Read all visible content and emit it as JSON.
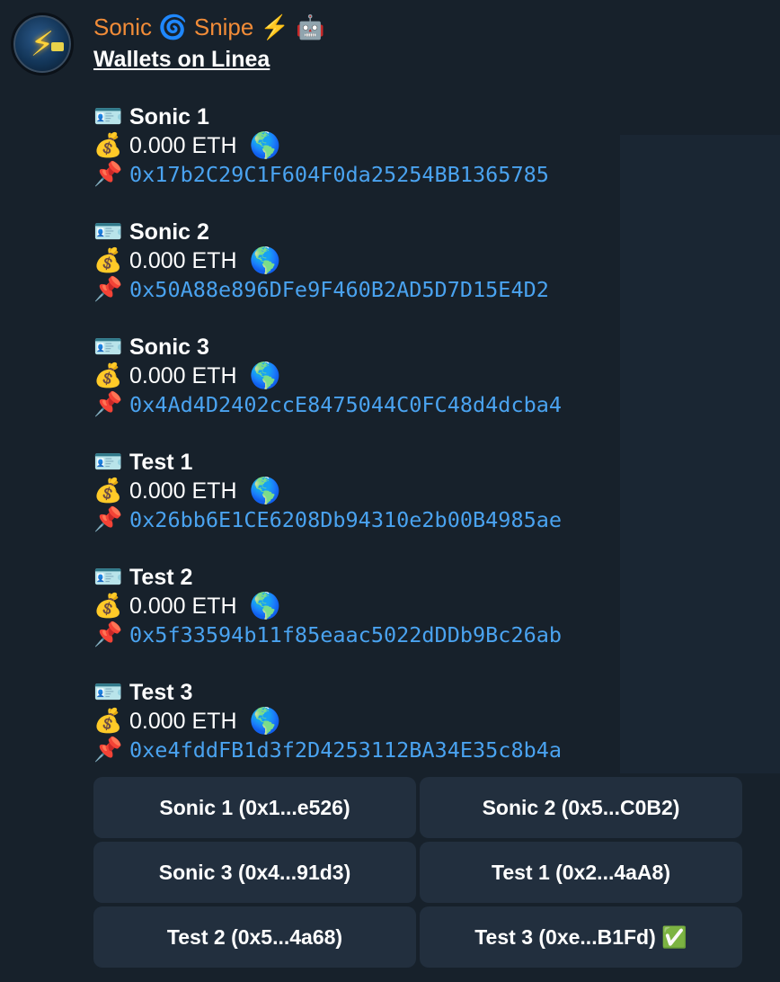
{
  "header": {
    "bot_name": "Sonic 🌀 Snipe ⚡ 🤖",
    "subtitle": "Wallets on Linea"
  },
  "icons": {
    "wallet_name": "🪪",
    "balance": "💰",
    "explorer": "🌎",
    "address": "📌"
  },
  "wallets": [
    {
      "name": "Sonic 1",
      "balance": "0.000 ETH",
      "address": "0x17b2C29C1F604F0da25254BB1365785"
    },
    {
      "name": "Sonic 2",
      "balance": "0.000 ETH",
      "address": "0x50A88e896DFe9F460B2AD5D7D15E4D2"
    },
    {
      "name": "Sonic 3",
      "balance": "0.000 ETH",
      "address": "0x4Ad4D2402ccE8475044C0FC48d4dcba4"
    },
    {
      "name": "Test 1",
      "balance": "0.000 ETH",
      "address": "0x26bb6E1CE6208Db94310e2b00B4985ae"
    },
    {
      "name": "Test 2",
      "balance": "0.000 ETH",
      "address": "0x5f33594b11f85eaac5022dDDb9Bc26ab"
    },
    {
      "name": "Test 3",
      "balance": "0.000 ETH",
      "address": "0xe4fddFB1d3f2D4253112BA34E35c8b4a"
    }
  ],
  "keyboard": [
    "Sonic 1 (0x1...e526)",
    "Sonic 2 (0x5...C0B2)",
    "Sonic 3 (0x4...91d3)",
    "Test 1 (0x2...4aA8)",
    "Test 2 (0x5...4a68)",
    "Test 3 (0xe...B1Fd) ✅"
  ],
  "colors": {
    "background": "#17212b",
    "bot_name": "#f28c38",
    "address": "#4aa3f0",
    "button_bg": "#222f3e"
  }
}
